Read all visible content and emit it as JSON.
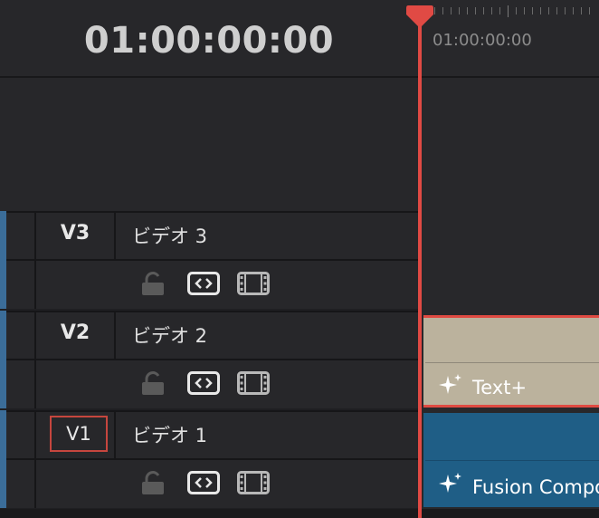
{
  "header": {
    "timecode": "01:00:00:00"
  },
  "ruler": {
    "timecode": "01:00:00:00"
  },
  "tracks": [
    {
      "id": "V3",
      "name": "ビデオ 3",
      "active": false
    },
    {
      "id": "V2",
      "name": "ビデオ 2",
      "active": false
    },
    {
      "id": "V1",
      "name": "ビデオ 1",
      "active": true
    }
  ],
  "clips": {
    "text": {
      "label": "Text+",
      "icon": "sparkle-icon",
      "color": "#bbb29d"
    },
    "fusion": {
      "label": "Fusion Compo",
      "icon": "sparkle-icon",
      "color": "#1f5e86"
    }
  },
  "colors": {
    "playhead": "#e04a44",
    "track_select": "#3b6d99",
    "active_patch": "#c6463e"
  }
}
